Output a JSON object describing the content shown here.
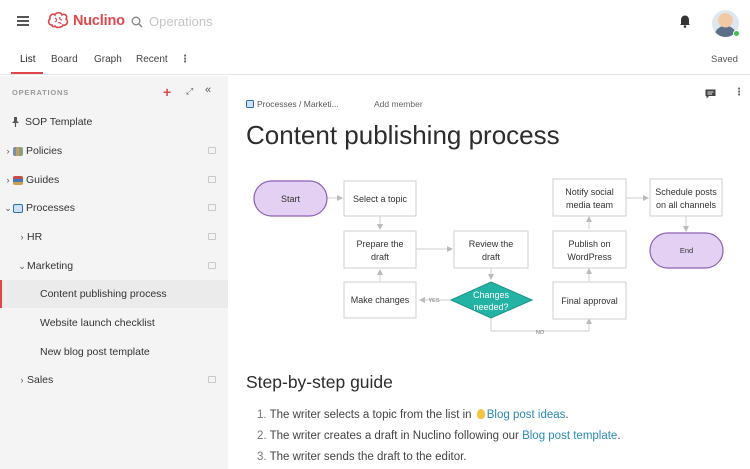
{
  "app": {
    "name": "Nuclino",
    "brand_color": "#e0474c"
  },
  "search": {
    "placeholder": "Operations"
  },
  "tabs": [
    {
      "label": "List",
      "active": true
    },
    {
      "label": "Board",
      "active": false
    },
    {
      "label": "Graph",
      "active": false
    },
    {
      "label": "Recent",
      "active": false
    }
  ],
  "status": {
    "saved": "Saved"
  },
  "sidebar": {
    "header": "OPERATIONS",
    "items": [
      {
        "label": "SOP Template",
        "icon": "pin-icon"
      },
      {
        "label": "Policies",
        "icon": "books-icon"
      },
      {
        "label": "Guides",
        "icon": "books-icon"
      },
      {
        "label": "Processes",
        "icon": "gear-box-icon"
      },
      {
        "label": "HR"
      },
      {
        "label": "Marketing"
      },
      {
        "label": "Content publishing process",
        "selected": true
      },
      {
        "label": "Website launch checklist"
      },
      {
        "label": "New blog post template"
      },
      {
        "label": "Sales"
      }
    ]
  },
  "document": {
    "breadcrumb": "Processes / Marketi...",
    "add_member": "Add member",
    "title": "Content publishing process",
    "flowchart": {
      "start": "Start",
      "select_topic": "Select a topic",
      "prepare_draft_1": "Prepare the",
      "prepare_draft_2": "draft",
      "review_draft_1": "Review the",
      "review_draft_2": "draft",
      "changes_needed_1": "Changes",
      "changes_needed_2": "needed?",
      "make_changes": "Make changes",
      "yes": "YES",
      "no": "NO",
      "final_approval": "Final approval",
      "publish_1": "Publish on",
      "publish_2": "WordPress",
      "notify_1": "Notify social",
      "notify_2": "media team",
      "schedule_1": "Schedule posts",
      "schedule_2": "on all channels",
      "end": "End"
    },
    "guide_heading": "Step-by-step guide",
    "steps": [
      {
        "num": "1.",
        "text": "The writer selects a topic from the list in",
        "link": "Blog post ideas",
        "after": "."
      },
      {
        "num": "2.",
        "text": "The writer creates a draft in Nuclino following our",
        "link": "Blog post template",
        "after": "."
      },
      {
        "num": "3.",
        "text": "The writer sends the draft to the editor.",
        "link": "",
        "after": ""
      }
    ]
  }
}
